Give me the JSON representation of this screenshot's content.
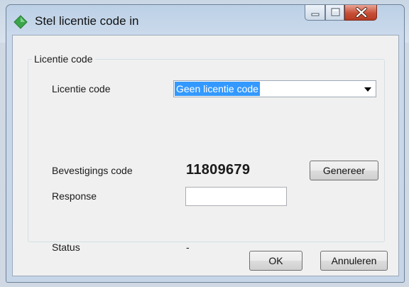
{
  "window": {
    "title": "Stel licentie code in"
  },
  "group": {
    "legend": "Licentie code"
  },
  "license": {
    "label": "Licentie code",
    "selected": "Geen licentie code"
  },
  "confirmation": {
    "label": "Bevestigings code",
    "code": "11809679",
    "generate_label": "Genereer"
  },
  "response": {
    "label": "Response",
    "value": ""
  },
  "status": {
    "label": "Status",
    "value": "-"
  },
  "footer": {
    "ok_label": "OK",
    "cancel_label": "Annuleren"
  },
  "colors": {
    "selection": "#3399ff",
    "close_button": "#c74f37",
    "dialog_background": "#f0f0f0",
    "icon_green": "#3aa54a"
  }
}
